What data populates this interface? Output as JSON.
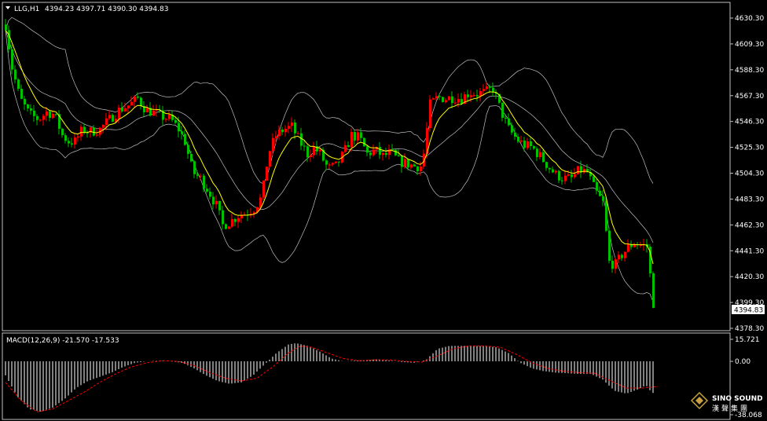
{
  "main_header": {
    "symbol": "LLG,H1",
    "ohlc": "4394.23 4397.71 4390.30 4394.83"
  },
  "price_axis": {
    "labels": [
      "4630.30",
      "4609.30",
      "4588.30",
      "4567.30",
      "4546.30",
      "4525.30",
      "4504.30",
      "4483.30",
      "4462.30",
      "4441.30",
      "4420.30",
      "4399.30",
      "4378.30"
    ],
    "current_price": "4394.83"
  },
  "macd": {
    "header": "MACD(12,26,9) -21.570 -17.533",
    "axis_labels": [
      "15.721",
      "0.00",
      "-38.068"
    ]
  },
  "logo": {
    "text_en": "SINO SOUND",
    "text_cn": "漢聲集團"
  },
  "colors": {
    "background": "#000000",
    "up_candle": "#ff0000",
    "down_candle": "#00c000",
    "ma_line": "#ffff00",
    "bollinger": "#c0c0c0",
    "macd_histogram": "#ffffff",
    "macd_signal": "#ff0000",
    "frame": "#c0c0c0"
  },
  "chart_data": [
    {
      "type": "candlestick",
      "title": "LLG,H1",
      "ylim": [
        4378.3,
        4630.3
      ],
      "close_path": [
        [
          0,
          4625
        ],
        [
          8,
          4590
        ],
        [
          18,
          4565
        ],
        [
          30,
          4552
        ],
        [
          42,
          4548
        ],
        [
          52,
          4554
        ],
        [
          62,
          4552
        ],
        [
          72,
          4535
        ],
        [
          80,
          4530
        ],
        [
          88,
          4530
        ],
        [
          98,
          4540
        ],
        [
          108,
          4538
        ],
        [
          120,
          4540
        ],
        [
          132,
          4548
        ],
        [
          145,
          4556
        ],
        [
          158,
          4560
        ],
        [
          168,
          4565
        ],
        [
          178,
          4556
        ],
        [
          190,
          4553
        ],
        [
          200,
          4550
        ],
        [
          210,
          4548
        ],
        [
          220,
          4540
        ],
        [
          228,
          4530
        ],
        [
          238,
          4505
        ],
        [
          248,
          4500
        ],
        [
          258,
          4490
        ],
        [
          268,
          4478
        ],
        [
          276,
          4462
        ],
        [
          286,
          4465
        ],
        [
          296,
          4470
        ],
        [
          306,
          4472
        ],
        [
          316,
          4476
        ],
        [
          326,
          4485
        ],
        [
          334,
          4520
        ],
        [
          344,
          4535
        ],
        [
          354,
          4540
        ],
        [
          364,
          4542
        ],
        [
          374,
          4530
        ],
        [
          384,
          4520
        ],
        [
          392,
          4525
        ],
        [
          400,
          4520
        ],
        [
          410,
          4508
        ],
        [
          420,
          4510
        ],
        [
          430,
          4520
        ],
        [
          440,
          4535
        ],
        [
          450,
          4533
        ],
        [
          460,
          4520
        ],
        [
          470,
          4523
        ],
        [
          480,
          4518
        ],
        [
          490,
          4521
        ],
        [
          500,
          4514
        ],
        [
          510,
          4512
        ],
        [
          520,
          4510
        ],
        [
          530,
          4510
        ],
        [
          540,
          4560
        ],
        [
          550,
          4566
        ],
        [
          560,
          4565
        ],
        [
          570,
          4566
        ],
        [
          580,
          4565
        ],
        [
          590,
          4570
        ],
        [
          600,
          4569
        ],
        [
          610,
          4570
        ],
        [
          620,
          4573
        ],
        [
          630,
          4555
        ],
        [
          640,
          4540
        ],
        [
          650,
          4532
        ],
        [
          660,
          4527
        ],
        [
          670,
          4525
        ],
        [
          680,
          4518
        ],
        [
          690,
          4510
        ],
        [
          700,
          4503
        ],
        [
          710,
          4500
        ],
        [
          720,
          4500
        ],
        [
          730,
          4507
        ],
        [
          740,
          4505
        ],
        [
          750,
          4490
        ],
        [
          760,
          4480
        ],
        [
          768,
          4432
        ],
        [
          776,
          4430
        ],
        [
          784,
          4438
        ],
        [
          792,
          4444
        ],
        [
          800,
          4448
        ],
        [
          808,
          4446
        ],
        [
          816,
          4445
        ],
        [
          822,
          4410
        ],
        [
          828,
          4394.83
        ]
      ]
    },
    {
      "type": "bar",
      "title": "MACD(12,26,9)",
      "ylim": [
        -38.068,
        15.721
      ],
      "signal_current": -17.533,
      "macd_current": -21.57,
      "macd_path": [
        [
          0,
          -10
        ],
        [
          15,
          -25
        ],
        [
          30,
          -34
        ],
        [
          45,
          -36
        ],
        [
          60,
          -33
        ],
        [
          75,
          -27
        ],
        [
          90,
          -19
        ],
        [
          105,
          -14
        ],
        [
          120,
          -11
        ],
        [
          135,
          -8
        ],
        [
          150,
          -4
        ],
        [
          165,
          -1
        ],
        [
          180,
          0
        ],
        [
          195,
          0.5
        ],
        [
          210,
          0
        ],
        [
          225,
          -1
        ],
        [
          240,
          -5
        ],
        [
          255,
          -10
        ],
        [
          270,
          -14
        ],
        [
          285,
          -16
        ],
        [
          300,
          -15
        ],
        [
          315,
          -10
        ],
        [
          330,
          -2
        ],
        [
          345,
          6
        ],
        [
          360,
          12
        ],
        [
          370,
          13
        ],
        [
          385,
          11
        ],
        [
          400,
          7
        ],
        [
          415,
          2
        ],
        [
          430,
          0
        ],
        [
          445,
          0.5
        ],
        [
          460,
          1
        ],
        [
          475,
          1.5
        ],
        [
          490,
          0.5
        ],
        [
          505,
          -0.5
        ],
        [
          520,
          -1
        ],
        [
          535,
          1
        ],
        [
          550,
          9
        ],
        [
          565,
          11
        ],
        [
          580,
          11
        ],
        [
          595,
          11
        ],
        [
          610,
          11
        ],
        [
          625,
          10
        ],
        [
          640,
          6
        ],
        [
          655,
          -1
        ],
        [
          670,
          -5
        ],
        [
          685,
          -7
        ],
        [
          700,
          -8
        ],
        [
          715,
          -8.5
        ],
        [
          730,
          -9
        ],
        [
          745,
          -9
        ],
        [
          760,
          -13
        ],
        [
          775,
          -21
        ],
        [
          790,
          -23
        ],
        [
          805,
          -20
        ],
        [
          815,
          -17
        ],
        [
          822,
          -22
        ],
        [
          830,
          -24
        ]
      ],
      "signal_path": [
        [
          0,
          -15
        ],
        [
          20,
          -28
        ],
        [
          40,
          -36
        ],
        [
          60,
          -34
        ],
        [
          80,
          -28
        ],
        [
          100,
          -22
        ],
        [
          120,
          -15
        ],
        [
          140,
          -9
        ],
        [
          160,
          -4
        ],
        [
          180,
          -1
        ],
        [
          200,
          0.5
        ],
        [
          220,
          0
        ],
        [
          240,
          -3
        ],
        [
          260,
          -8
        ],
        [
          280,
          -12
        ],
        [
          300,
          -14
        ],
        [
          320,
          -12
        ],
        [
          340,
          -4
        ],
        [
          360,
          6
        ],
        [
          375,
          11
        ],
        [
          390,
          10
        ],
        [
          410,
          6
        ],
        [
          430,
          2
        ],
        [
          450,
          0.5
        ],
        [
          470,
          1
        ],
        [
          490,
          1
        ],
        [
          510,
          0
        ],
        [
          530,
          -0.5
        ],
        [
          550,
          4
        ],
        [
          570,
          9
        ],
        [
          590,
          11
        ],
        [
          610,
          11
        ],
        [
          630,
          10
        ],
        [
          650,
          5
        ],
        [
          670,
          -1
        ],
        [
          690,
          -5
        ],
        [
          710,
          -7
        ],
        [
          730,
          -8
        ],
        [
          750,
          -8.5
        ],
        [
          770,
          -14
        ],
        [
          790,
          -19
        ],
        [
          810,
          -19
        ],
        [
          830,
          -18
        ]
      ]
    }
  ]
}
